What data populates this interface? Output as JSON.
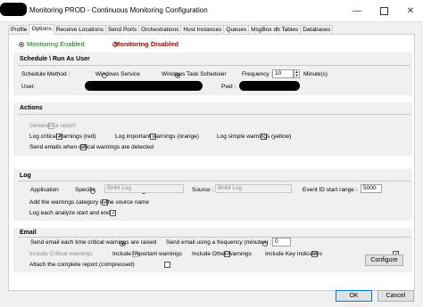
{
  "window": {
    "title": "Monitoring PROD - Continuous Monitoring Configuration",
    "minimize_icon": "minimize-icon",
    "maximize_icon": "maximize-icon",
    "close_icon": "close-icon"
  },
  "tabs": [
    {
      "label": "Profile"
    },
    {
      "label": "Options"
    },
    {
      "label": "Receive Locations"
    },
    {
      "label": "Send Ports"
    },
    {
      "label": "Orchestrations"
    },
    {
      "label": "Host Instances"
    },
    {
      "label": "Queues"
    },
    {
      "label": "MsgBox db Tables"
    },
    {
      "label": "Databases"
    }
  ],
  "monitoring": {
    "enabled_label": "Monitoring Enabled",
    "disabled_label": "Monitoring Disabled",
    "enabled_color": "#008000",
    "disabled_color": "#c00000"
  },
  "schedule": {
    "title": "Schedule \\ Run As User",
    "method_label": "Schedule Method :",
    "windows_service_label": "Windows Service",
    "task_scheduler_label": "Windows Task Scheduler",
    "frequency_label": "Frequency :",
    "frequency_value": "10",
    "frequency_unit": "Minute(s)",
    "user_label": "User:",
    "pwd_label": "Pwd :"
  },
  "actions": {
    "title": "Actions",
    "generate_report": "Generate a report",
    "log_critical": "Log critical warnings (red)",
    "log_important": "Log important warnings (orange)",
    "log_simple": "Log simple warnings (yellow)",
    "send_emails": "Send emails when critical warnings are detected"
  },
  "log": {
    "title": "Log",
    "application_label": "Application",
    "specific_label": "Specific",
    "log_name": "BHM Log",
    "source_label": "Source :",
    "source_value": "BHM Log",
    "event_id_label": "Event ID start range :",
    "event_id_value": "5000",
    "add_category": "Add the warnings category in the source name",
    "log_each": "Log each analyze start and end"
  },
  "email": {
    "title": "Email",
    "send_each_time": "Send email each time critical warnings are raised",
    "send_frequency": "Send email using a frequency (minutes) :",
    "frequency_value": "0",
    "include_critical": "Include Critical warnings",
    "include_important": "Include Important warnings",
    "include_other": "Include Other warnings",
    "include_key": "Include Key Indicators",
    "configure_label": "Configure",
    "attach_report": "Attach the complete report (compressed)"
  },
  "footer": {
    "ok_label": "OK",
    "cancel_label": "Cancel"
  }
}
